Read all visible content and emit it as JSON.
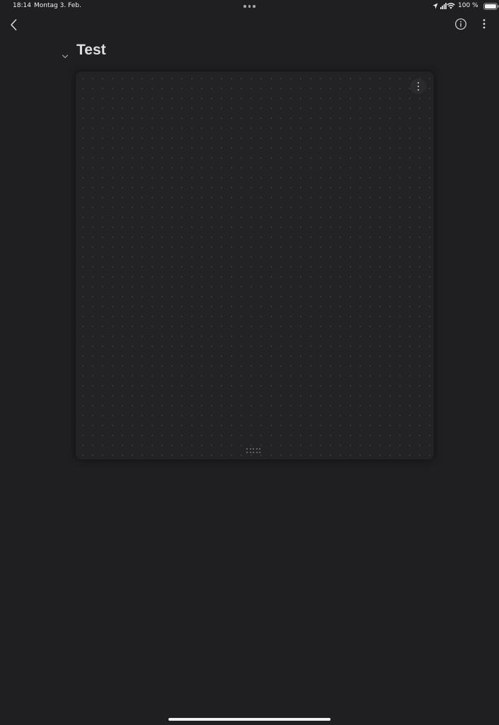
{
  "status_bar": {
    "time": "18:14",
    "date": "Montag 3. Feb.",
    "battery_percent": "100 %",
    "battery_level": 1.0,
    "icons": [
      "location-arrow-icon",
      "cellular-signal-icon",
      "wifi-icon",
      "battery-icon"
    ]
  },
  "toolbar": {
    "icons": [
      "back-chevron-icon",
      "info-icon",
      "more-vertical-icon"
    ]
  },
  "page": {
    "title": "Test",
    "title_icon": "chevron-down-icon"
  },
  "canvas": {
    "menu_icon": "more-vertical-icon",
    "handle_icon": "resize-handle-icon",
    "background": "dot-grid"
  },
  "colors": {
    "background": "#1f1f21",
    "card": "#232325",
    "title": "#dcdde0"
  }
}
